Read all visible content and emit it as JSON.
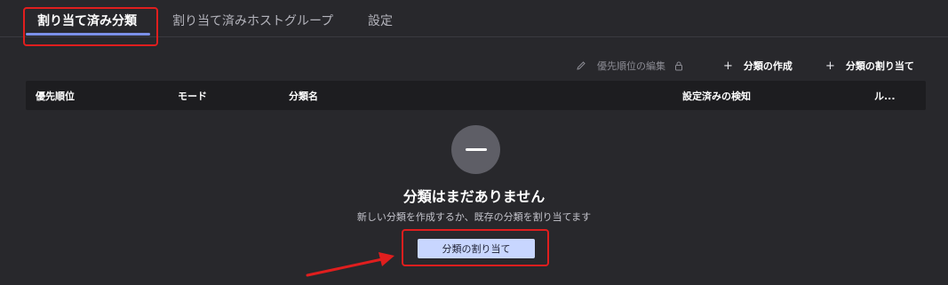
{
  "tabs": [
    {
      "label": "割り当て済み分類",
      "active": true
    },
    {
      "label": "割り当て済みホストグループ",
      "active": false
    },
    {
      "label": "設定",
      "active": false
    }
  ],
  "toolbar": {
    "edit_priority": "優先順位の編集",
    "create_classification": "分類の作成",
    "assign_classification": "分類の割り当て"
  },
  "table": {
    "columns": [
      "優先順位",
      "モード",
      "分類名",
      "設定済みの検知",
      "ル..."
    ]
  },
  "empty_state": {
    "title": "分類はまだありません",
    "subtitle": "新しい分類を作成するか、既存の分類を割り当てます",
    "button_label": "分類の割り当て"
  },
  "colors": {
    "background": "#28282c",
    "header_bg": "#1d1d20",
    "accent": "#7b90e8",
    "button_bg": "#c8d6ff",
    "highlight": "#e01e1e"
  }
}
